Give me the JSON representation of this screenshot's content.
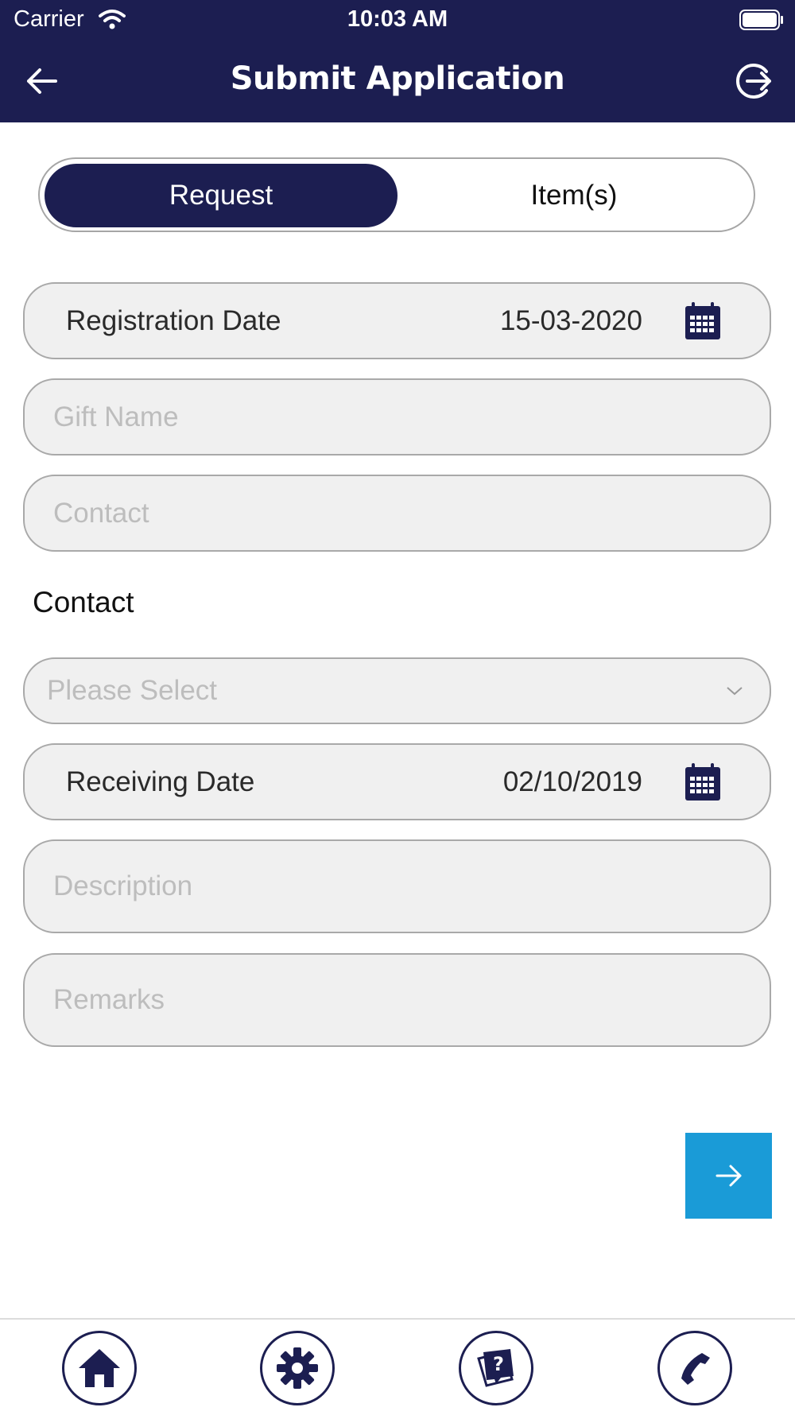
{
  "status_bar": {
    "carrier": "Carrier",
    "time": "10:03 AM"
  },
  "header": {
    "title": "Submit Application"
  },
  "tabs": {
    "request": "Request",
    "items": "Item(s)"
  },
  "form": {
    "registration_date": {
      "label": "Registration Date",
      "value": "15-03-2020"
    },
    "gift_name": {
      "placeholder": "Gift Name",
      "value": ""
    },
    "contact_input": {
      "placeholder": "Contact",
      "value": ""
    },
    "contact_section_label": "Contact",
    "contact_select": {
      "selected": "Please Select"
    },
    "receiving_date": {
      "label": "Receiving Date",
      "value": "02/10/2019"
    },
    "description": {
      "placeholder": "Description",
      "value": ""
    },
    "remarks": {
      "placeholder": "Remarks",
      "value": ""
    }
  },
  "colors": {
    "navy": "#1c1e51",
    "accent_blue": "#1a9bd7",
    "field_bg": "#f0f0f0"
  },
  "icons": [
    "wifi-icon",
    "battery-icon",
    "back-arrow-icon",
    "logout-icon",
    "calendar-icon",
    "chevron-down-icon",
    "arrow-right-icon",
    "home-icon",
    "gear-icon",
    "help-icon",
    "phone-icon"
  ]
}
